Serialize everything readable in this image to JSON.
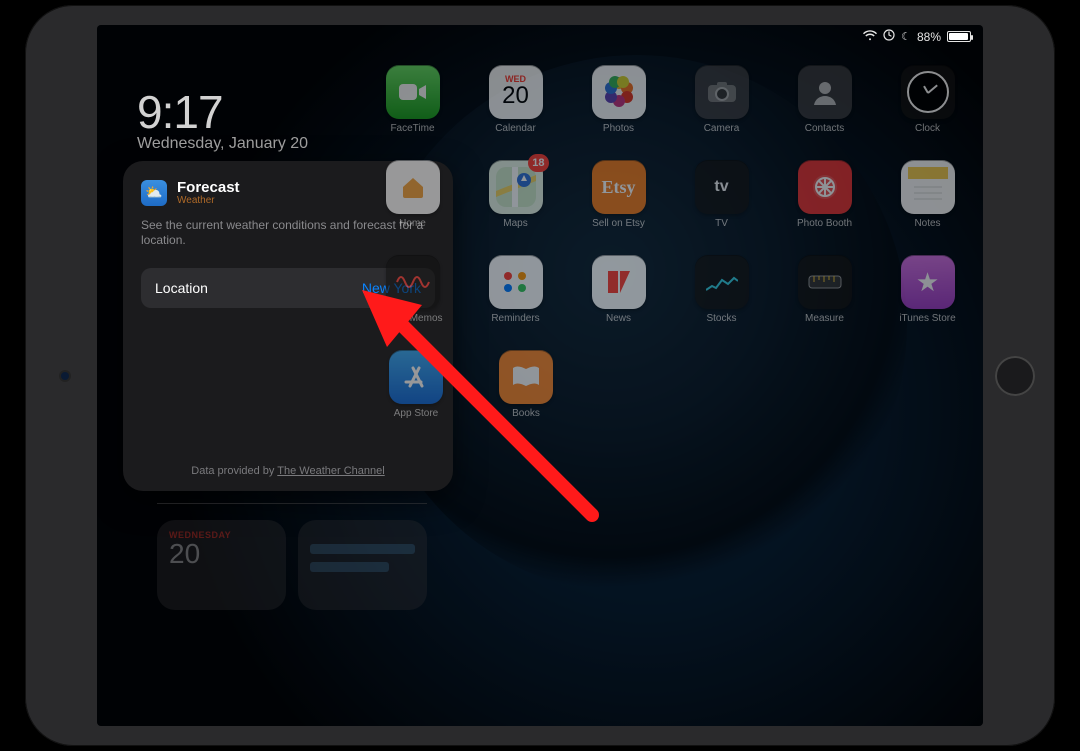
{
  "status": {
    "battery_pct": "88%",
    "wifi_icon": "wifi-icon",
    "rotation_lock_icon": "rotation-lock-icon",
    "dnd_icon": "moon-icon"
  },
  "clock": {
    "time": "9:17",
    "date": "Wednesday, January 20"
  },
  "popover": {
    "title": "Forecast",
    "subtitle": "Weather",
    "description": "See the current weather conditions and forecast for a location.",
    "location_label": "Location",
    "location_value": "New York",
    "provider_prefix": "Data provided by ",
    "provider_name": "The Weather Channel"
  },
  "ghost_calendar": {
    "dow": "WEDNESDAY",
    "day": "20"
  },
  "calendar_tile": {
    "dow": "WED",
    "day": "20"
  },
  "badges": {
    "maps": "18"
  },
  "apps": {
    "row1": [
      "FaceTime",
      "Calendar",
      "Photos",
      "Camera",
      "Contacts",
      "Clock"
    ],
    "row2": [
      "Home",
      "Maps",
      "Sell on Etsy",
      "TV",
      "Photo Booth",
      "Notes"
    ],
    "row3": [
      "Voice Memos",
      "Reminders",
      "News",
      "Stocks",
      "Measure",
      "iTunes Store"
    ],
    "row4": [
      "App Store",
      "Books"
    ]
  }
}
